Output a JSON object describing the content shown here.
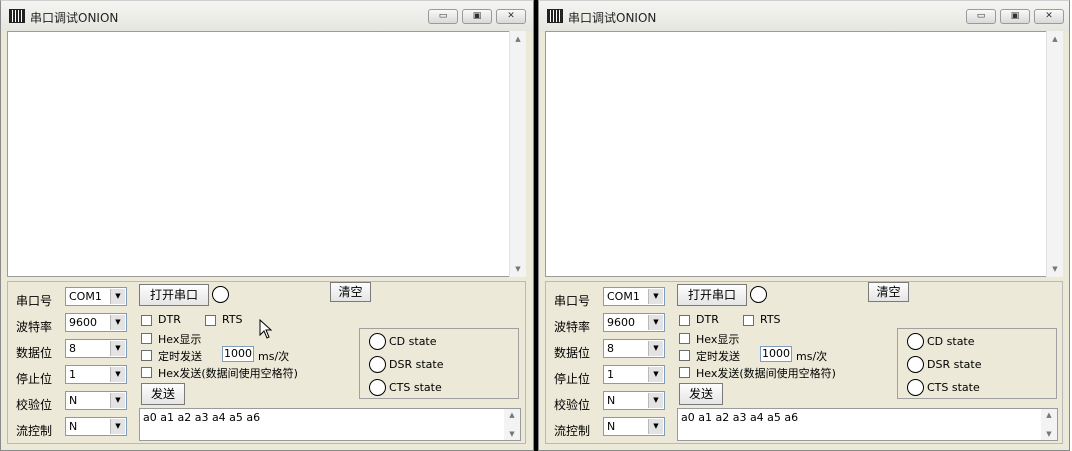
{
  "windows": [
    {
      "title": "串口调试ONION",
      "controls": {
        "minimize": "▭",
        "maximize": "▣",
        "close": "✕"
      },
      "port": {
        "label": "串口号",
        "value": "COM1"
      },
      "baud": {
        "label": "波特率",
        "value": "9600"
      },
      "databits": {
        "label": "数据位",
        "value": "8"
      },
      "stopbits": {
        "label": "停止位",
        "value": "1"
      },
      "parity": {
        "label": "校验位",
        "value": "N"
      },
      "flow": {
        "label": "流控制",
        "value": "N"
      },
      "open_button": "打开串口",
      "clear_button": "清空",
      "dtr_label": "DTR",
      "rts_label": "RTS",
      "hex_display_label": "Hex显示",
      "timed_send_label": "定时发送",
      "interval_value": "1000",
      "interval_unit": "ms/次",
      "hex_send_label": "Hex发送(数据间使用空格符)",
      "send_button": "发送",
      "cd_state": "CD state",
      "dsr_state": "DSR state",
      "cts_state": "CTS state",
      "send_text": "a0 a1 a2 a3 a4 a5 a6"
    },
    {
      "title": "串口调试ONION",
      "controls": {
        "minimize": "▭",
        "maximize": "▣",
        "close": "✕"
      },
      "port": {
        "label": "串口号",
        "value": "COM1"
      },
      "baud": {
        "label": "波特率",
        "value": "9600"
      },
      "databits": {
        "label": "数据位",
        "value": "8"
      },
      "stopbits": {
        "label": "停止位",
        "value": "1"
      },
      "parity": {
        "label": "校验位",
        "value": "N"
      },
      "flow": {
        "label": "流控制",
        "value": "N"
      },
      "open_button": "打开串口",
      "clear_button": "清空",
      "dtr_label": "DTR",
      "rts_label": "RTS",
      "hex_display_label": "Hex显示",
      "timed_send_label": "定时发送",
      "interval_value": "1000",
      "interval_unit": "ms/次",
      "hex_send_label": "Hex发送(数据间使用空格符)",
      "send_button": "发送",
      "cd_state": "CD state",
      "dsr_state": "DSR state",
      "cts_state": "CTS state",
      "send_text": "a0 a1 a2 a3 a4 a5 a6"
    }
  ],
  "icons": {
    "scroll_up": "▲",
    "scroll_down": "▼",
    "dropdown": "▼",
    "app_icon": "barcode-icon",
    "cursor": "mouse-pointer-icon"
  }
}
